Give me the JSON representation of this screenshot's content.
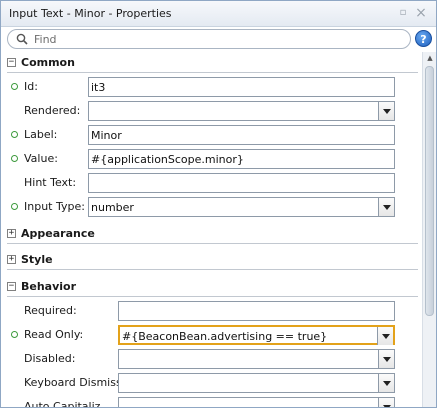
{
  "window": {
    "title": "Input Text - Minor - Properties",
    "menu_glyph": "▫",
    "close_glyph": "×"
  },
  "search": {
    "placeholder": "Find",
    "value": ""
  },
  "help": {
    "label": "?"
  },
  "sections": {
    "common": {
      "label": "Common",
      "toggle": "−"
    },
    "appearance": {
      "label": "Appearance",
      "toggle": "+"
    },
    "style": {
      "label": "Style",
      "toggle": "+"
    },
    "behavior": {
      "label": "Behavior",
      "toggle": "−"
    }
  },
  "common": {
    "id": {
      "label": "Id:",
      "value": "it3"
    },
    "rendered": {
      "label": "Rendered:",
      "value": ""
    },
    "label": {
      "label": "Label:",
      "value": "Minor"
    },
    "value": {
      "label": "Value:",
      "value": "#{applicationScope.minor}"
    },
    "hint_text": {
      "label": "Hint Text:",
      "value": ""
    },
    "input_type": {
      "label": "Input Type:",
      "value": "number"
    }
  },
  "behavior": {
    "required": {
      "label": "Required:",
      "value": ""
    },
    "read_only": {
      "label": "Read Only:",
      "value": "#{BeaconBean.advertising == true}"
    },
    "disabled": {
      "label": "Disabled:",
      "value": ""
    },
    "keyboard_dismiss": {
      "label": "Keyboard Dismiss:",
      "value": ""
    },
    "auto_capitalize": {
      "label": "Auto Capitaliz",
      "value": ""
    }
  },
  "colors": {
    "required_dot": "#3d9a3d",
    "focus_border": "#e3a21a",
    "help_blue": "#1d5fbf"
  }
}
